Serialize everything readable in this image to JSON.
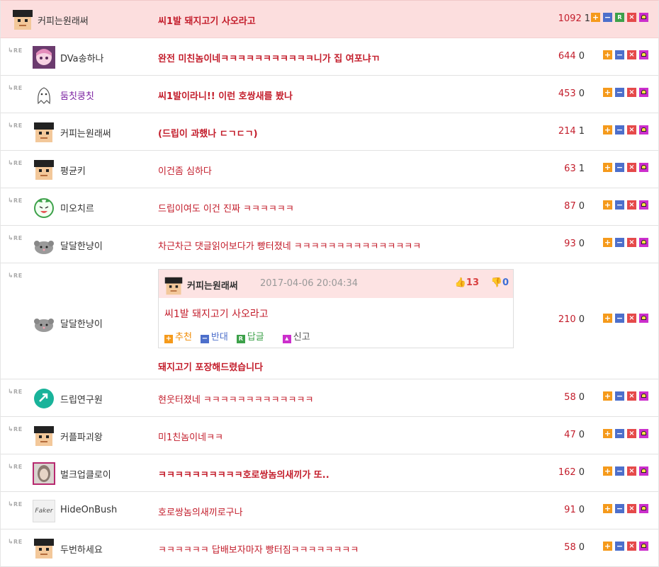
{
  "rows": [
    {
      "re": false,
      "avatar": "pixel-face-black-hair",
      "nick": "커피는원래써",
      "content": "씨1발 돼지고기 사오라고",
      "bold": true,
      "up": "1092",
      "down": "1",
      "reply": true
    },
    {
      "re": true,
      "avatar": "anime-girl-pink",
      "nick": "DVa송하나",
      "content": "완전 미친놈이네ㅋㅋㅋㅋㅋㅋㅋㅋㅋㅋㅋ니가 집 여포냐ㄲ",
      "bold": true,
      "up": "644",
      "down": "0"
    },
    {
      "re": true,
      "avatar": "ghost-sketch",
      "nick": "둠칫쿵칫",
      "content": "씨1발이라니!! 이런 호쌍새를 봤나",
      "bold": true,
      "up": "453",
      "down": "0",
      "purple": true
    },
    {
      "re": true,
      "avatar": "pixel-face-black-hair",
      "nick": "커피는원래써",
      "content": "(드립이 과했나 ㄷㄱㄷㄱ)",
      "bold": true,
      "up": "214",
      "down": "1"
    },
    {
      "re": true,
      "avatar": "pixel-face-black-hair",
      "nick": "평균키",
      "content": "이건좀 심하다",
      "bold": false,
      "up": "63",
      "down": "1"
    },
    {
      "re": true,
      "avatar": "green-laughing-face",
      "nick": "미오치르",
      "content": "드립이여도 이건 진짜 ㅋㅋㅋㅋㅋㅋ",
      "bold": false,
      "up": "87",
      "down": "0"
    },
    {
      "re": true,
      "avatar": "grey-mouse",
      "nick": "달달한냥이",
      "content": "차근차근 댓글읽어보다가 빵터졌네 ㅋㅋㅋㅋㅋㅋㅋㅋㅋㅋㅋㅋㅋㅋㅋ",
      "bold": false,
      "up": "93",
      "down": "0"
    },
    {
      "re": true,
      "avatar": "grey-mouse",
      "nick": "달달한냥이",
      "quote": true,
      "content": "돼지고기 포장해드렸습니다",
      "bold": true,
      "up": "210",
      "down": "0"
    },
    {
      "re": true,
      "avatar": "teal-circle-arrow",
      "nick": "드립연구원",
      "content": "현웃터졌네 ㅋㅋㅋㅋㅋㅋㅋㅋㅋㅋㅋㅋㅋ",
      "bold": false,
      "up": "58",
      "down": "0"
    },
    {
      "re": true,
      "avatar": "pixel-face-black-hair",
      "nick": "커플파괴왕",
      "content": "미1친놈이네ㅋㅋ",
      "bold": false,
      "up": "47",
      "down": "0"
    },
    {
      "re": true,
      "avatar": "photo-face",
      "nick": "벌크업클로이",
      "content": "ㅋㅋㅋㅋㅋㅋㅋㅋㅋㅋ호로쌍놈의새끼가 또..",
      "bold": true,
      "up": "162",
      "down": "0"
    },
    {
      "re": true,
      "avatar": "faker-text-logo",
      "nick": "HideOnBush",
      "content": "호로쌍놈의새끼로구나",
      "bold": false,
      "up": "91",
      "down": "0"
    },
    {
      "re": true,
      "avatar": "pixel-face-black-hair",
      "nick": "두번하세요",
      "content": "ㅋㅋㅋㅋㅋㅋ 답배보자마자 빵터짐ㅋㅋㅋㅋㅋㅋㅋㅋ",
      "bold": false,
      "up": "58",
      "down": "0"
    }
  ],
  "re_label": "RE",
  "quote": {
    "nick": "커피는원래써",
    "date": "2017-04-06 20:04:34",
    "likes": "13",
    "dislikes": "0",
    "text": "씨1발 돼지고기 사오라고",
    "actions": {
      "recommend": "추천",
      "oppose": "반대",
      "reply": "답글",
      "report": "신고"
    }
  },
  "avatar_faker_text": "Faker",
  "colors": {
    "accent_red": "#c31d2b",
    "top_bg": "#fcdede",
    "up": "#f59a1b",
    "down": "#4d6fcb",
    "reply": "#3da14a",
    "delete": "#e54a4a",
    "report": "#cc2fcc"
  }
}
